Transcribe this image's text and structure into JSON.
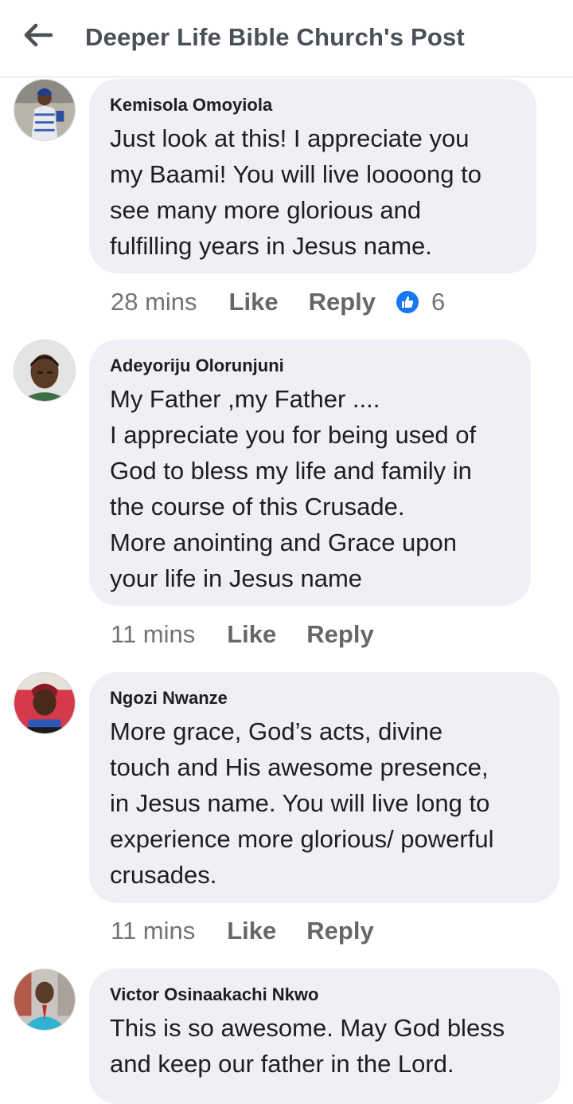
{
  "header": {
    "title": "Deeper Life Bible Church's Post",
    "back_icon": "back-arrow-icon"
  },
  "comments": [
    {
      "author": "Kemisola Omoyiola",
      "lines": [
        "Just look at this! I appreciate you",
        "my Baami! You will live loooong to",
        "see many more glorious and",
        "fulfilling years in Jesus name."
      ],
      "time": "28 mins",
      "like_label": "Like",
      "reply_label": "Reply",
      "reaction_icon": "thumbs-up-icon",
      "reaction_count": "6"
    },
    {
      "author": "Adeyoriju Olorunjuni",
      "lines": [
        "My Father ,my Father ....",
        "I appreciate you for being used of",
        "God to bless my life and family in",
        "the course of this Crusade.",
        "More anointing and Grace upon",
        "your life in Jesus name"
      ],
      "time": "11 mins",
      "like_label": "Like",
      "reply_label": "Reply"
    },
    {
      "author": "Ngozi Nwanze",
      "lines": [
        "More grace, God’s acts, divine",
        "touch and His awesome presence,",
        "in Jesus name. You will live long to",
        "experience more glorious/ powerful",
        "crusades."
      ],
      "time": "11 mins",
      "like_label": "Like",
      "reply_label": "Reply"
    },
    {
      "author": "Victor Osinaakachi Nkwo",
      "lines": [
        "This is so awesome. May God bless",
        "and keep our father in the Lord."
      ]
    }
  ],
  "colors": {
    "bubble": "#eff0f5",
    "reaction_blue": "#1877f2",
    "meta_gray": "#707378"
  }
}
